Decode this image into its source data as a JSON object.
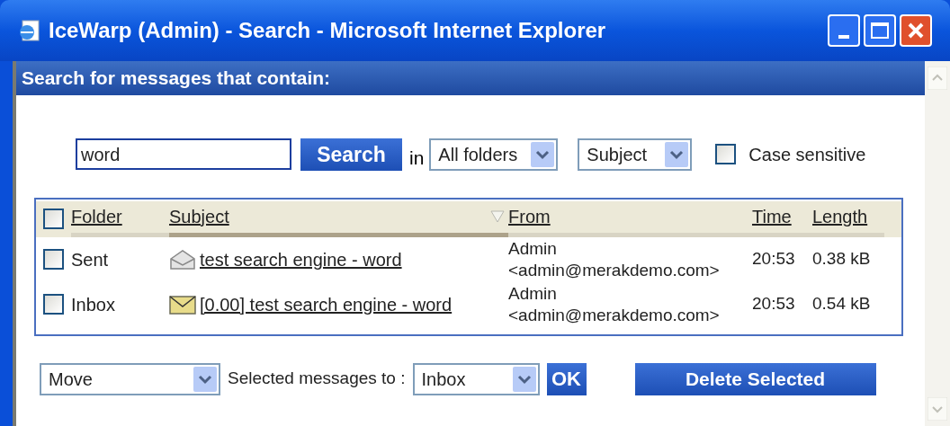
{
  "window": {
    "title": "IceWarp (Admin) - Search - Microsoft Internet Explorer"
  },
  "header": "Search for messages that contain:",
  "search": {
    "value": "word",
    "button": "Search",
    "in_label": "in",
    "folder": "All folders",
    "field": "Subject",
    "case_sensitive": {
      "label": "Case sensitive",
      "checked": false
    }
  },
  "table": {
    "select_all_checked": false,
    "columns": [
      {
        "label": "Folder",
        "sorted": false
      },
      {
        "label": "Subject",
        "sorted": true
      },
      {
        "label": "From",
        "sorted": false
      },
      {
        "label": "Time",
        "sorted": false
      },
      {
        "label": "Length",
        "sorted": false
      }
    ],
    "rows": [
      {
        "checked": false,
        "folder": "Sent",
        "kind": "read",
        "subject": "test search engine - word",
        "from_name": "Admin",
        "from_email": "<admin@merakdemo.com>",
        "time": "20:53",
        "length": "0.38 kB"
      },
      {
        "checked": false,
        "folder": "Inbox",
        "kind": "unread",
        "subject": "[0.00] test search engine - word",
        "from_name": "Admin",
        "from_email": "<admin@merakdemo.com>",
        "time": "20:53",
        "length": "0.54 kB"
      }
    ]
  },
  "footer": {
    "action": "Move",
    "label": "Selected messages to :",
    "target": "Inbox",
    "ok": "OK",
    "delete": "Delete Selected"
  }
}
